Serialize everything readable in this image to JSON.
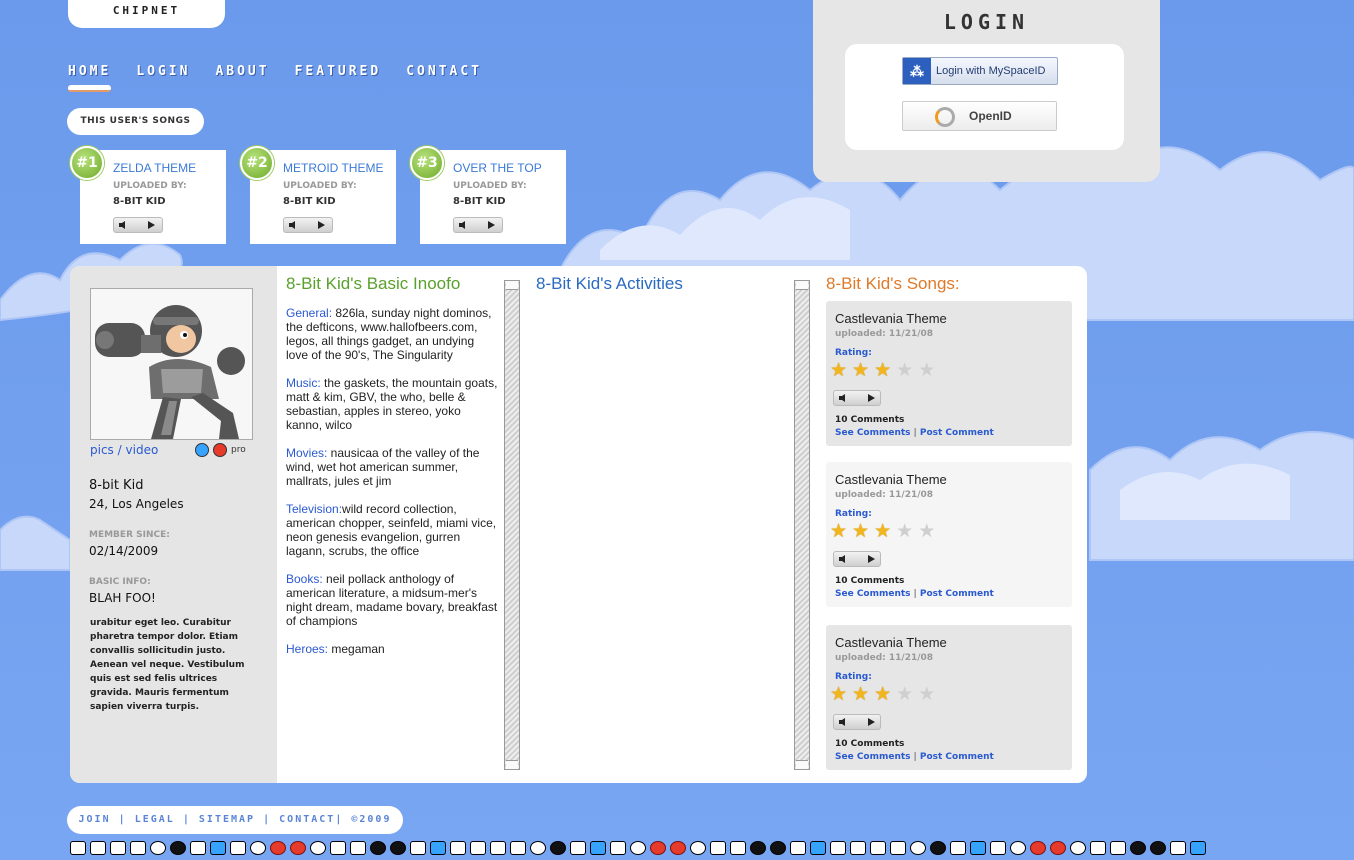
{
  "site": {
    "logo": "CHIPNET"
  },
  "nav": [
    {
      "label": "HOME",
      "active": true
    },
    {
      "label": "LOGIN"
    },
    {
      "label": "ABOUT"
    },
    {
      "label": "FEATURED"
    },
    {
      "label": "CONTACT"
    }
  ],
  "user_songs": {
    "pill": "THIS USER'S SONGS",
    "items": [
      {
        "rank": "#1",
        "title": "ZELDA THEME",
        "uploaded_label": "UPLOADED BY:",
        "uploader": "8-BIT KID"
      },
      {
        "rank": "#2",
        "title": "METROID THEME",
        "uploaded_label": "UPLOADED BY:",
        "uploader": "8-BIT KID"
      },
      {
        "rank": "#3",
        "title": "OVER THE TOP",
        "uploaded_label": "UPLOADED BY:",
        "uploader": "8-BIT KID"
      }
    ]
  },
  "login": {
    "title": "LOGIN",
    "myspace": {
      "icon": "myspace-icon",
      "label": "Login with MySpaceID"
    },
    "openid": {
      "icon": "openid-icon",
      "label": "OpenID"
    }
  },
  "profile": {
    "pics": "pics",
    "slash": "/",
    "video": "video",
    "pro": "pro",
    "name": "8-bit Kid",
    "age_location": "24, Los Angeles",
    "member_since_label": "MEMBER SINCE:",
    "member_since": "02/14/2009",
    "basic_info_label": "BASIC INFO:",
    "basic_info": "BLAH FOO!",
    "bio": "urabitur eget leo. Curabitur pharetra tempor dolor. Etiam convallis sollicitudin justo. Aenean vel neque.  Vestibulum quis est sed felis ultrices gravida. Mauris fermentum sapien viverra turpis."
  },
  "basic_info": {
    "title": "8-Bit Kid's Basic Inoofo",
    "items": [
      {
        "key": "General:",
        "value": "  826la, sunday night dominos, the defticons, www.hallofbeers.com, legos, all things gadget, an undying love of the 90's, The Singularity"
      },
      {
        "key": "Music:",
        "value": " the gaskets, the mountain goats, matt & kim, GBV, the who, belle & sebastian, apples in stereo, yoko kanno, wilco"
      },
      {
        "key": "Movies:",
        "value": " nausicaa of the valley of the wind, wet hot american summer, mallrats, jules et jim"
      },
      {
        "key": "Television:",
        "value": "wild record collection, american chopper, seinfeld, miami vice, neon genesis evangelion, gurren lagann, scrubs, the office"
      },
      {
        "key": "Books:",
        "value": " neil pollack anthology of american literature, a midsum-mer's night dream, madame bovary, breakfast of champions"
      },
      {
        "key": "Heroes:",
        "value": " megaman"
      }
    ]
  },
  "activities": {
    "title": "8-Bit Kid's Activities"
  },
  "songs": {
    "title": "8-Bit Kid's Songs:",
    "items": [
      {
        "title": "Castlevania Theme",
        "uploaded": "uploaded: 11/21/08",
        "rating_label": "Rating:",
        "rating": 3,
        "max": 5,
        "comments": "10 Comments",
        "see": "See Comments",
        "sep": "|",
        "post": "Post Comment"
      },
      {
        "title": "Castlevania Theme",
        "uploaded": "uploaded: 11/21/08",
        "rating_label": "Rating:",
        "rating": 3,
        "max": 5,
        "comments": "10 Comments",
        "see": "See Comments",
        "sep": "|",
        "post": "Post Comment"
      },
      {
        "title": "Castlevania Theme",
        "uploaded": "uploaded: 11/21/08",
        "rating_label": "Rating:",
        "rating": 3,
        "max": 5,
        "comments": "10 Comments",
        "see": "See Comments",
        "sep": "|",
        "post": "Post Comment"
      }
    ]
  },
  "footer": {
    "join": "JOIN",
    "legal": "LEGAL",
    "sitemap": "SITEMAP",
    "contact": "CONTACT",
    "copyright": "©2009",
    "sep": "|"
  },
  "colors": {
    "sky": "#6f9dee",
    "link": "#2a5ad0",
    "basic_title": "#5aa02c",
    "activities_title": "#2a6ac0",
    "songs_title": "#e07a2a"
  }
}
